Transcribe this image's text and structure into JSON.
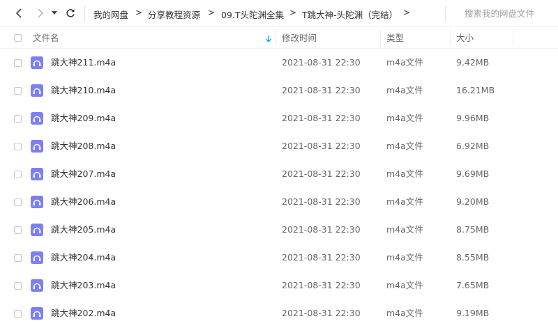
{
  "toolbar": {
    "breadcrumb": [
      "我的网盘",
      "分享教程资源",
      "09.T头陀渊全集",
      "T跳大神-头陀渊（完结）"
    ],
    "breadcrumb_separator": ">",
    "search_placeholder": "搜索我的网盘文件"
  },
  "table": {
    "columns": {
      "name": "文件名",
      "modified": "修改时间",
      "type": "类型",
      "size": "大小"
    },
    "rows": [
      {
        "name": "跳大神211.m4a",
        "modified": "2021-08-31 22:30",
        "type": "m4a文件",
        "size": "9.42MB"
      },
      {
        "name": "跳大神210.m4a",
        "modified": "2021-08-31 22:30",
        "type": "m4a文件",
        "size": "16.21MB"
      },
      {
        "name": "跳大神209.m4a",
        "modified": "2021-08-31 22:30",
        "type": "m4a文件",
        "size": "9.96MB"
      },
      {
        "name": "跳大神208.m4a",
        "modified": "2021-08-31 22:30",
        "type": "m4a文件",
        "size": "6.92MB"
      },
      {
        "name": "跳大神207.m4a",
        "modified": "2021-08-31 22:30",
        "type": "m4a文件",
        "size": "9.69MB"
      },
      {
        "name": "跳大神206.m4a",
        "modified": "2021-08-31 22:30",
        "type": "m4a文件",
        "size": "9.20MB"
      },
      {
        "name": "跳大神205.m4a",
        "modified": "2021-08-31 22:30",
        "type": "m4a文件",
        "size": "8.75MB"
      },
      {
        "name": "跳大神204.m4a",
        "modified": "2021-08-31 22:30",
        "type": "m4a文件",
        "size": "8.55MB"
      },
      {
        "name": "跳大神203.m4a",
        "modified": "2021-08-31 22:30",
        "type": "m4a文件",
        "size": "7.65MB"
      },
      {
        "name": "跳大神202.m4a",
        "modified": "2021-08-31 22:30",
        "type": "m4a文件",
        "size": "9.19MB"
      }
    ]
  },
  "icons": {
    "back": "chevron-left-icon",
    "forward": "chevron-right-icon",
    "history": "caret-down-icon",
    "refresh": "refresh-icon",
    "sort": "sort-down-arrow-icon",
    "file": "audio-file-icon"
  },
  "colors": {
    "accent": "#06a7ff",
    "file_icon": "#7c80f4",
    "text": "#333333",
    "muted": "#666666"
  }
}
